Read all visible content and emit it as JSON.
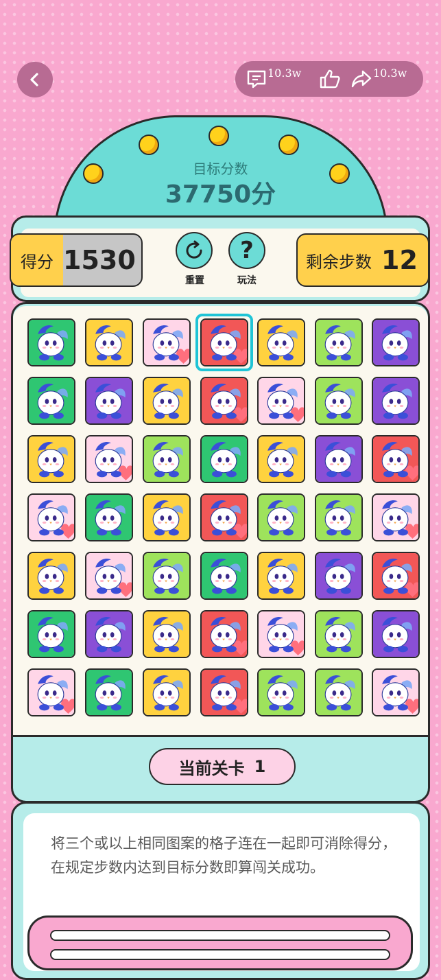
{
  "header": {
    "back_icon": "chevron-left-icon",
    "comments_count": "10.3w",
    "shares_count": "10.3w",
    "icons": [
      "comment-icon",
      "thumbs-up-icon",
      "share-icon"
    ]
  },
  "target": {
    "label": "目标分数",
    "value": "37750分"
  },
  "score": {
    "label": "得分",
    "value": "1530",
    "progress": 0.4
  },
  "steps": {
    "label": "剩余步数",
    "value": "12"
  },
  "actions": {
    "reset_label": "重置",
    "help_label": "玩法",
    "reset_icon": "refresh-icon",
    "help_icon": "question-icon"
  },
  "board": {
    "rows": [
      [
        "green",
        "yellow",
        "pink",
        "red",
        "yellow",
        "lime",
        "purple"
      ],
      [
        "green",
        "purple",
        "yellow",
        "red",
        "pink",
        "lime",
        "purple"
      ],
      [
        "yellow",
        "pink",
        "lime",
        "green",
        "yellow",
        "purple",
        "red"
      ],
      [
        "pink",
        "green",
        "yellow",
        "red",
        "lime",
        "lime",
        "pink"
      ],
      [
        "yellow",
        "pink",
        "lime",
        "green",
        "yellow",
        "purple",
        "red"
      ],
      [
        "green",
        "purple",
        "yellow",
        "red",
        "pink",
        "lime",
        "purple"
      ],
      [
        "pink",
        "green",
        "yellow",
        "red",
        "lime",
        "lime",
        "pink"
      ]
    ],
    "selected": {
      "row": 0,
      "col": 3
    },
    "colors": {
      "green": "#2fc672",
      "yellow": "#ffd23f",
      "pink": "#ffd6e8",
      "red": "#f25757",
      "lime": "#9ee35c",
      "purple": "#8a4fd6"
    }
  },
  "level": {
    "label": "当前关卡",
    "number": "1"
  },
  "rules": {
    "text": "将三个或以上相同图案的格子连在一起即可消除得分，在规定步数内达到目标分数即算闯关成功。"
  },
  "theme": {
    "teal": "#6cdcd6",
    "pink": "#f9a8cf",
    "bulb": "#ffd21c"
  }
}
